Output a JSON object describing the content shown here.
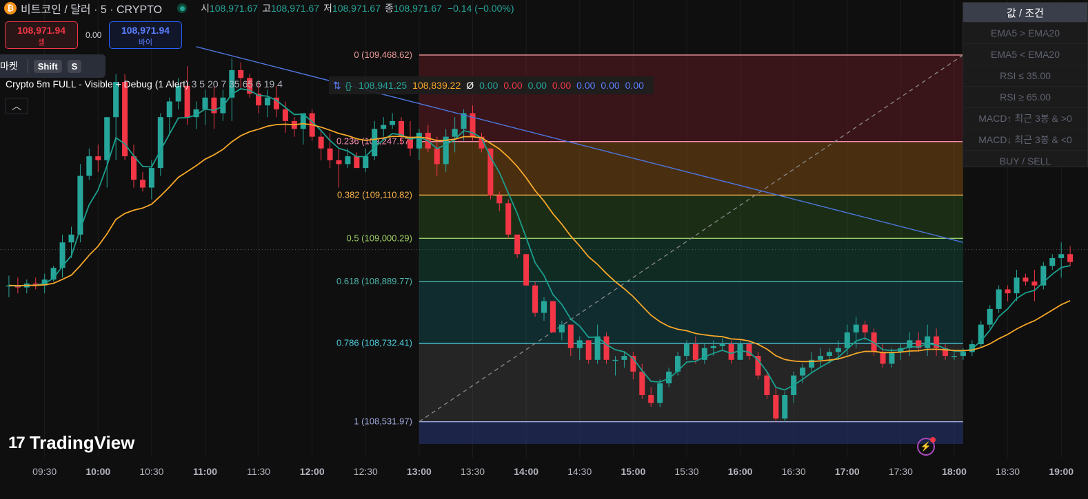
{
  "header": {
    "icon": "bitcoin-icon",
    "symbol": "비트코인 / 달러 · 5 · CRYPTO",
    "open_label": "시",
    "open": "108,971.67",
    "high_label": "고",
    "high": "108,971.67",
    "low_label": "저",
    "low": "108,971.67",
    "close_label": "종",
    "close": "108,971.67",
    "change": "−0.14 (−0.00%)"
  },
  "trade": {
    "sell_price": "108,971.94",
    "sell_label": "셀",
    "spread": "0.00",
    "buy_price": "108,971.94",
    "buy_label": "바이"
  },
  "market_bar": {
    "label": "마켓",
    "key1": "Shift",
    "key2": "S"
  },
  "indicator": {
    "title": "Crypto 5m FULL - Visible + Debug (1 Alert)",
    "params": "3 5 20 7 35 65 6 19 4",
    "values": [
      {
        "v": "108,941.25",
        "c": "#26a69a"
      },
      {
        "v": "108,839.22",
        "c": "#f7a829"
      },
      {
        "v": "Ø",
        "c": "#ffffff"
      },
      {
        "v": "0.00",
        "c": "#26a69a"
      },
      {
        "v": "0.00",
        "c": "#f23645"
      },
      {
        "v": "0.00",
        "c": "#26a69a"
      },
      {
        "v": "0.00",
        "c": "#f23645"
      },
      {
        "v": "0.00",
        "c": "#5b7fff"
      },
      {
        "v": "0.00",
        "c": "#5b7fff"
      },
      {
        "v": "0.00",
        "c": "#5b7fff"
      }
    ]
  },
  "conditions": {
    "header": "값 / 조건",
    "rows": [
      "EMA5 > EMA20",
      "EMA5 < EMA20",
      "RSI ≤ 35.00",
      "RSI ≥ 65.00",
      "MACD↑ 최근 3봉 & >0",
      "MACD↓ 최근 3봉 & <0",
      "BUY / SELL"
    ]
  },
  "logo": "TradingView",
  "colors": {
    "up": "#26a69a",
    "down": "#f23645",
    "ema_fast": "#1ba08f",
    "ema_slow": "#f7a829",
    "trendline": "#4c74d9"
  },
  "chart_data": {
    "type": "candlestick",
    "title": "",
    "x_ticks": [
      "09:30",
      "10:00",
      "10:30",
      "11:00",
      "11:30",
      "12:00",
      "12:30",
      "13:00",
      "13:30",
      "14:00",
      "14:30",
      "15:00",
      "15:30",
      "16:00",
      "16:30",
      "17:00",
      "17:30",
      "18:00",
      "18:30",
      "19:00"
    ],
    "x_range": [
      "09:05",
      "19:15"
    ],
    "y_range": [
      108440,
      109560
    ],
    "interval_minutes": 5,
    "first_bar_time": "09:10",
    "candles": [
      [
        108880,
        108905,
        108850,
        108880
      ],
      [
        108880,
        108900,
        108860,
        108875
      ],
      [
        108875,
        108895,
        108860,
        108885
      ],
      [
        108885,
        108900,
        108870,
        108880
      ],
      [
        108880,
        108910,
        108860,
        108895
      ],
      [
        108895,
        108930,
        108890,
        108925
      ],
      [
        108925,
        109010,
        108900,
        108990
      ],
      [
        108990,
        109030,
        108950,
        109010
      ],
      [
        109010,
        109190,
        108990,
        109160
      ],
      [
        109160,
        109230,
        109150,
        109210
      ],
      [
        109210,
        109240,
        109170,
        109200
      ],
      [
        109200,
        109260,
        109130,
        109310
      ],
      [
        109310,
        109420,
        109200,
        109400
      ],
      [
        109400,
        109420,
        109200,
        109210
      ],
      [
        109210,
        109240,
        109130,
        109150
      ],
      [
        109150,
        109170,
        109120,
        109130
      ],
      [
        109130,
        109200,
        109100,
        109180
      ],
      [
        109180,
        109320,
        109160,
        109310
      ],
      [
        109310,
        109360,
        109270,
        109350
      ],
      [
        109350,
        109410,
        109330,
        109390
      ],
      [
        109390,
        109440,
        109290,
        109310
      ],
      [
        109310,
        109350,
        109280,
        109330
      ],
      [
        109330,
        109380,
        109290,
        109360
      ],
      [
        109360,
        109390,
        109280,
        109320
      ],
      [
        109320,
        109380,
        109300,
        109360
      ],
      [
        109360,
        109460,
        109300,
        109430
      ],
      [
        109430,
        109450,
        109380,
        109410
      ],
      [
        109410,
        109420,
        109360,
        109370
      ],
      [
        109370,
        109400,
        109320,
        109340
      ],
      [
        109340,
        109380,
        109310,
        109360
      ],
      [
        109360,
        109390,
        109310,
        109330
      ],
      [
        109330,
        109350,
        109270,
        109300
      ],
      [
        109300,
        109310,
        109260,
        109280
      ],
      [
        109280,
        109320,
        109240,
        109320
      ],
      [
        109320,
        109330,
        109250,
        109260
      ],
      [
        109260,
        109280,
        109200,
        109230
      ],
      [
        109230,
        109270,
        109180,
        109200
      ],
      [
        109200,
        109230,
        109130,
        109190
      ],
      [
        109190,
        109230,
        109180,
        109210
      ],
      [
        109210,
        109220,
        109180,
        109180
      ],
      [
        109180,
        109230,
        109170,
        109210
      ],
      [
        109210,
        109300,
        109200,
        109280
      ],
      [
        109280,
        109310,
        109260,
        109290
      ],
      [
        109290,
        109320,
        109280,
        109300
      ],
      [
        109300,
        109310,
        109240,
        109260
      ],
      [
        109260,
        109300,
        109210,
        109230
      ],
      [
        109230,
        109280,
        109200,
        109270
      ],
      [
        109270,
        109290,
        109220,
        109230
      ],
      [
        109230,
        109260,
        109160,
        109190
      ],
      [
        109190,
        109280,
        109170,
        109260
      ],
      [
        109260,
        109310,
        109220,
        109280
      ],
      [
        109280,
        109330,
        109250,
        109320
      ],
      [
        109320,
        109340,
        109250,
        109260
      ],
      [
        109260,
        109270,
        109220,
        109230
      ],
      [
        109230,
        109230,
        109100,
        109110
      ],
      [
        109110,
        109120,
        109070,
        109090
      ],
      [
        109090,
        109100,
        109000,
        109010
      ],
      [
        109010,
        109010,
        108950,
        108960
      ],
      [
        108960,
        108960,
        108880,
        108880
      ],
      [
        108880,
        108890,
        108800,
        108810
      ],
      [
        108810,
        108850,
        108790,
        108840
      ],
      [
        108840,
        108840,
        108760,
        108760
      ],
      [
        108760,
        108790,
        108740,
        108780
      ],
      [
        108780,
        108780,
        108700,
        108720
      ],
      [
        108720,
        108750,
        108690,
        108740
      ],
      [
        108740,
        108740,
        108680,
        108690
      ],
      [
        108690,
        108780,
        108680,
        108750
      ],
      [
        108750,
        108760,
        108680,
        108690
      ],
      [
        108690,
        108700,
        108650,
        108690
      ],
      [
        108690,
        108710,
        108670,
        108700
      ],
      [
        108700,
        108710,
        108640,
        108660
      ],
      [
        108660,
        108680,
        108590,
        108600
      ],
      [
        108600,
        108620,
        108570,
        108580
      ],
      [
        108580,
        108640,
        108570,
        108630
      ],
      [
        108630,
        108670,
        108620,
        108660
      ],
      [
        108660,
        108710,
        108650,
        108700
      ],
      [
        108700,
        108740,
        108690,
        108730
      ],
      [
        108730,
        108750,
        108680,
        108690
      ],
      [
        108690,
        108730,
        108680,
        108720
      ],
      [
        108720,
        108740,
        108700,
        108725
      ],
      [
        108725,
        108745,
        108715,
        108730
      ],
      [
        108730,
        108740,
        108680,
        108690
      ],
      [
        108690,
        108740,
        108690,
        108730
      ],
      [
        108730,
        108740,
        108690,
        108700
      ],
      [
        108700,
        108710,
        108640,
        108650
      ],
      [
        108650,
        108660,
        108590,
        108600
      ],
      [
        108600,
        108620,
        108530,
        108540
      ],
      [
        108540,
        108610,
        108530,
        108600
      ],
      [
        108600,
        108660,
        108580,
        108650
      ],
      [
        108650,
        108680,
        108630,
        108670
      ],
      [
        108670,
        108710,
        108660,
        108690
      ],
      [
        108690,
        108720,
        108670,
        108700
      ],
      [
        108700,
        108720,
        108680,
        108710
      ],
      [
        108710,
        108740,
        108690,
        108720
      ],
      [
        108720,
        108780,
        108700,
        108760
      ],
      [
        108760,
        108800,
        108720,
        108780
      ],
      [
        108780,
        108790,
        108740,
        108760
      ],
      [
        108760,
        108770,
        108700,
        108710
      ],
      [
        108710,
        108730,
        108670,
        108680
      ],
      [
        108680,
        108720,
        108670,
        108710
      ],
      [
        108710,
        108730,
        108690,
        108720
      ],
      [
        108720,
        108760,
        108700,
        108740
      ],
      [
        108740,
        108760,
        108710,
        108720
      ],
      [
        108720,
        108780,
        108700,
        108750
      ],
      [
        108750,
        108770,
        108700,
        108720
      ],
      [
        108720,
        108730,
        108690,
        108700
      ],
      [
        108700,
        108710,
        108690,
        108700
      ],
      [
        108700,
        108720,
        108690,
        108710
      ],
      [
        108710,
        108740,
        108700,
        108730
      ],
      [
        108730,
        108790,
        108720,
        108780
      ],
      [
        108780,
        108830,
        108770,
        108820
      ],
      [
        108820,
        108880,
        108810,
        108870
      ],
      [
        108870,
        108880,
        108840,
        108860
      ],
      [
        108860,
        108920,
        108840,
        108900
      ],
      [
        108900,
        108910,
        108880,
        108890
      ],
      [
        108890,
        108920,
        108840,
        108880
      ],
      [
        108880,
        108940,
        108870,
        108930
      ],
      [
        108930,
        108960,
        108920,
        108950
      ],
      [
        108950,
        108990,
        108900,
        108960
      ],
      [
        108960,
        108980,
        108930,
        108940
      ]
    ],
    "series": [
      {
        "name": "EMA (fast)",
        "color": "#1ba08f"
      },
      {
        "name": "EMA (slow)",
        "color": "#f7a829"
      }
    ],
    "fib_levels": [
      {
        "ratio": 0,
        "price": 109468.62,
        "label": "0 (109,468.62)",
        "line": "#ef9a9a",
        "fill": "rgba(178,34,52,0.26)"
      },
      {
        "ratio": 0.236,
        "price": 109247.57,
        "label": "0.236 (109,247.57)",
        "line": "#f48fb1",
        "fill": "rgba(210,120,20,0.30)"
      },
      {
        "ratio": 0.382,
        "price": 109110.82,
        "label": "0.382 (109,110.82)",
        "line": "#ffb74d",
        "fill": "rgba(60,130,40,0.28)"
      },
      {
        "ratio": 0.5,
        "price": 109000.29,
        "label": "0.5 (109,000.29)",
        "line": "#9ccc65",
        "fill": "rgba(20,110,80,0.30)"
      },
      {
        "ratio": 0.618,
        "price": 108889.77,
        "label": "0.618 (108,889.77)",
        "line": "#4db6ac",
        "fill": "rgba(20,100,110,0.35)"
      },
      {
        "ratio": 0.786,
        "price": 108732.41,
        "label": "0.786 (108,732.41)",
        "line": "#4dd0e1",
        "fill": "rgba(120,120,120,0.22)"
      },
      {
        "ratio": 1,
        "price": 108531.97,
        "label": "1 (108,531.97)",
        "line": "#9fa8da",
        "fill": "rgba(40,55,120,0.55)"
      }
    ],
    "fib_time_range": [
      "13:00",
      "18:05"
    ],
    "fib_bottom_price": 108475,
    "trendline": {
      "start": [
        "10:55",
        109490
      ],
      "end": [
        "18:05",
        108990
      ]
    },
    "fib_diagonal": {
      "start": [
        "13:00",
        108531.97
      ],
      "end": [
        "18:05",
        109468.62
      ]
    },
    "current_price": 108971.67
  }
}
